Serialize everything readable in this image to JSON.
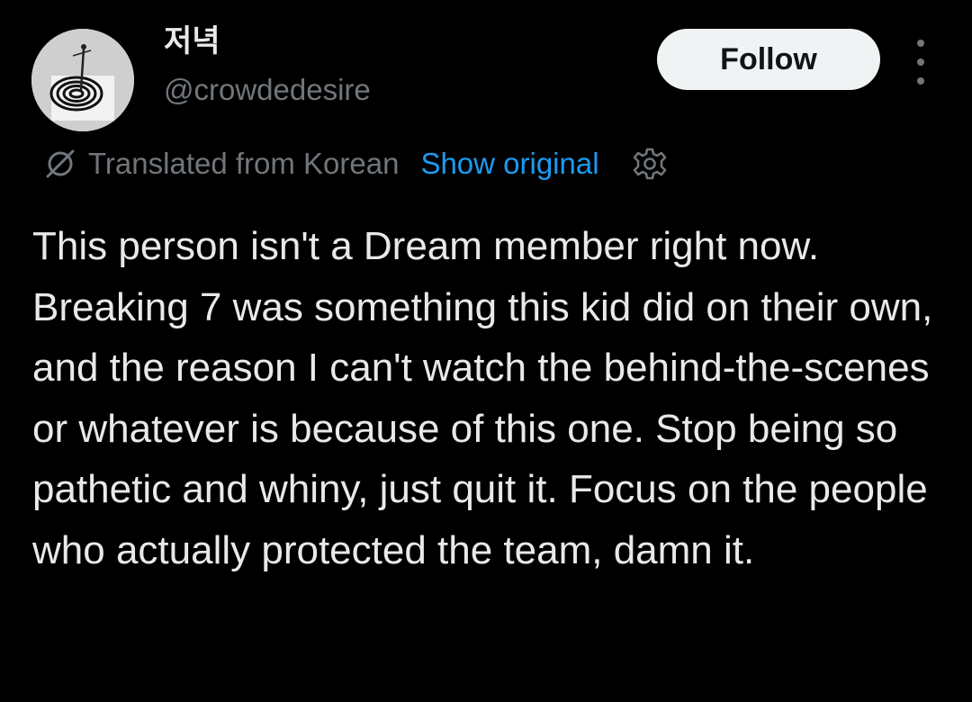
{
  "user": {
    "display_name": "저녁",
    "handle": "@crowdedesire",
    "avatar_icon": "avatar-spiral-figure"
  },
  "actions": {
    "follow_label": "Follow",
    "more_icon": "more-vertical-icon"
  },
  "translation": {
    "icon": "translate-icon",
    "translated_label": "Translated from Korean",
    "show_original_label": "Show original",
    "settings_icon": "gear-icon"
  },
  "tweet": {
    "text": "This person isn't a Dream member right now. Breaking 7 was something this kid did on their own, and the reason I can't watch the behind-the-scenes or whatever is because of this one. Stop being so pathetic and whiny, just quit it. Focus on the people who actually protected the team, damn it."
  },
  "colors": {
    "background": "#000000",
    "text_primary": "#e7e9ea",
    "text_secondary": "#71767b",
    "link": "#1d9bf0",
    "follow_button_bg": "#eff3f4"
  }
}
